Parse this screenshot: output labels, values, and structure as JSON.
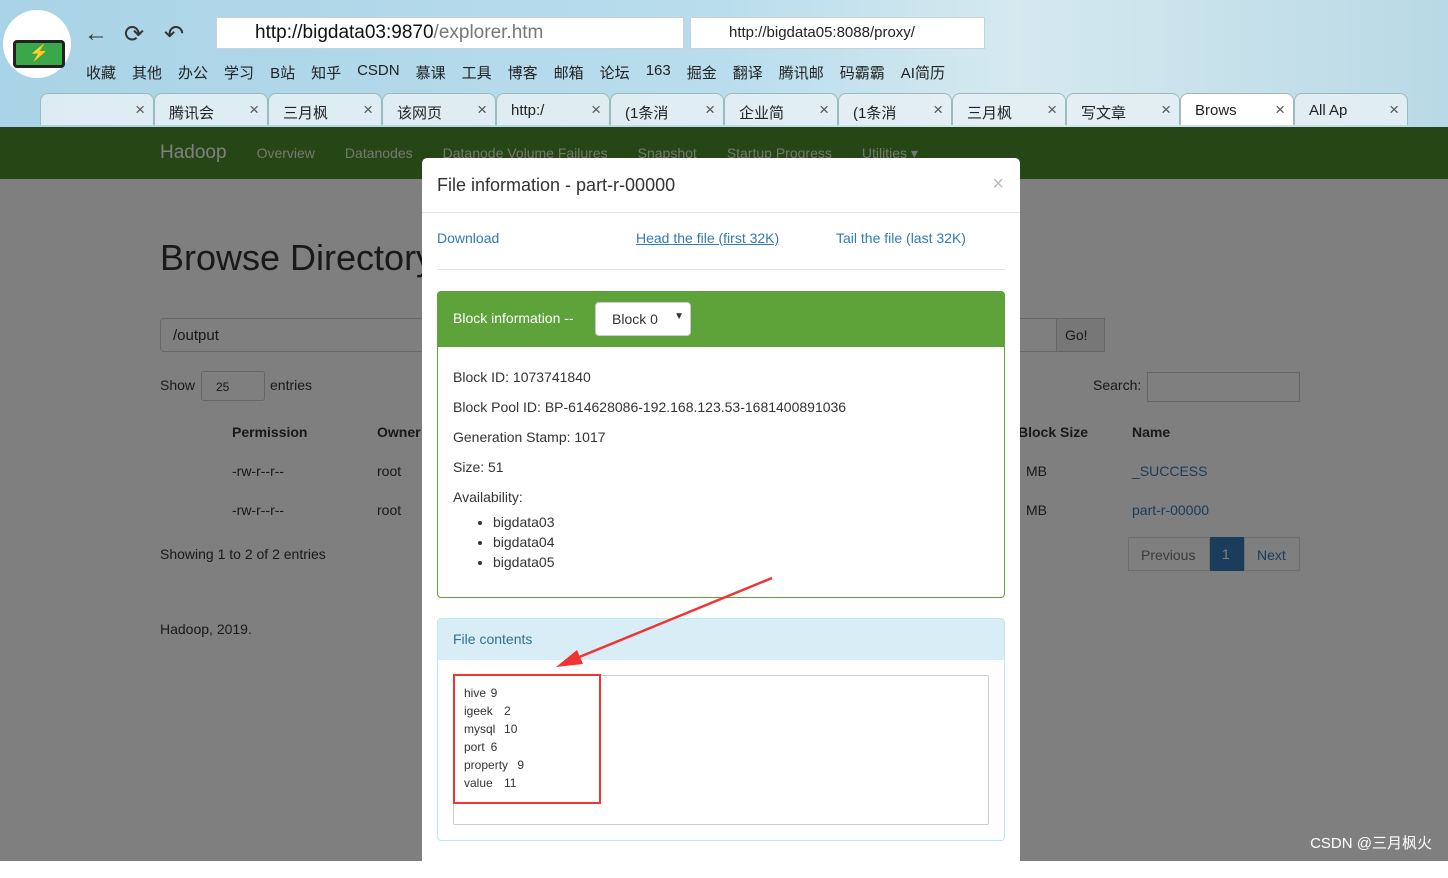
{
  "browser": {
    "url": "http://bigdata03:9870/explorer.htm",
    "url_host": "http://bigdata03:9870",
    "url_path": "/explorer.htm",
    "url2": "http://bigdata05:8088/proxy/",
    "bookmarks": [
      "收藏",
      "其他",
      "办公",
      "学习",
      "B站",
      "知乎",
      "CSDN",
      "慕课",
      "工具",
      "博客",
      "邮箱",
      "论坛",
      "163",
      "掘金",
      "翻译",
      "腾讯邮",
      "码霸霸",
      "AI简历"
    ],
    "tabs": [
      "",
      "腾讯会",
      "三月枫",
      "该网页",
      "http:/",
      "(1条消",
      "企业简",
      "(1条消",
      "三月枫",
      "写文章",
      "Brows",
      "All Ap"
    ],
    "active_tab": 10
  },
  "navbar": {
    "brand": "Hadoop",
    "items": [
      "Overview",
      "Datanodes",
      "Datanode Volume Failures",
      "Snapshot",
      "Startup Progress",
      "Utilities ▾"
    ]
  },
  "background_page": {
    "title": "Browse Directory",
    "path": "/output",
    "go": "Go!",
    "show": "Show",
    "entries_value": "25",
    "entries": "entries",
    "search": "Search:",
    "columns": [
      "Permission",
      "Owner",
      "Block Size",
      "Name"
    ],
    "rows": [
      {
        "perm": "-rw-r--r--",
        "owner": "root",
        "size": "MB",
        "name": "_SUCCESS"
      },
      {
        "perm": "-rw-r--r--",
        "owner": "root",
        "size": "MB",
        "name": "part-r-00000"
      }
    ],
    "showing": "Showing 1 to 2 of 2 entries",
    "prev": "Previous",
    "page": "1",
    "next": "Next",
    "footer": "Hadoop, 2019."
  },
  "modal": {
    "title": "File information - part-r-00000",
    "download": "Download",
    "head": "Head the file (first 32K)",
    "tail": "Tail the file (last 32K)",
    "block_label": "Block information --",
    "block_select": "Block 0",
    "block_id": "Block ID: 1073741840",
    "pool_id": "Block Pool ID: BP-614628086-192.168.123.53-1681400891036",
    "gen_stamp": "Generation Stamp: 1017",
    "size": "Size: 51",
    "availability": "Availability:",
    "nodes": [
      "bigdata03",
      "bigdata04",
      "bigdata05"
    ],
    "contents_label": "File contents",
    "contents": "hive\t9\nigeek\t2\nmysql\t10\nport\t6\nproperty\t9\nvalue\t11"
  },
  "watermark": "CSDN @三月枫火"
}
